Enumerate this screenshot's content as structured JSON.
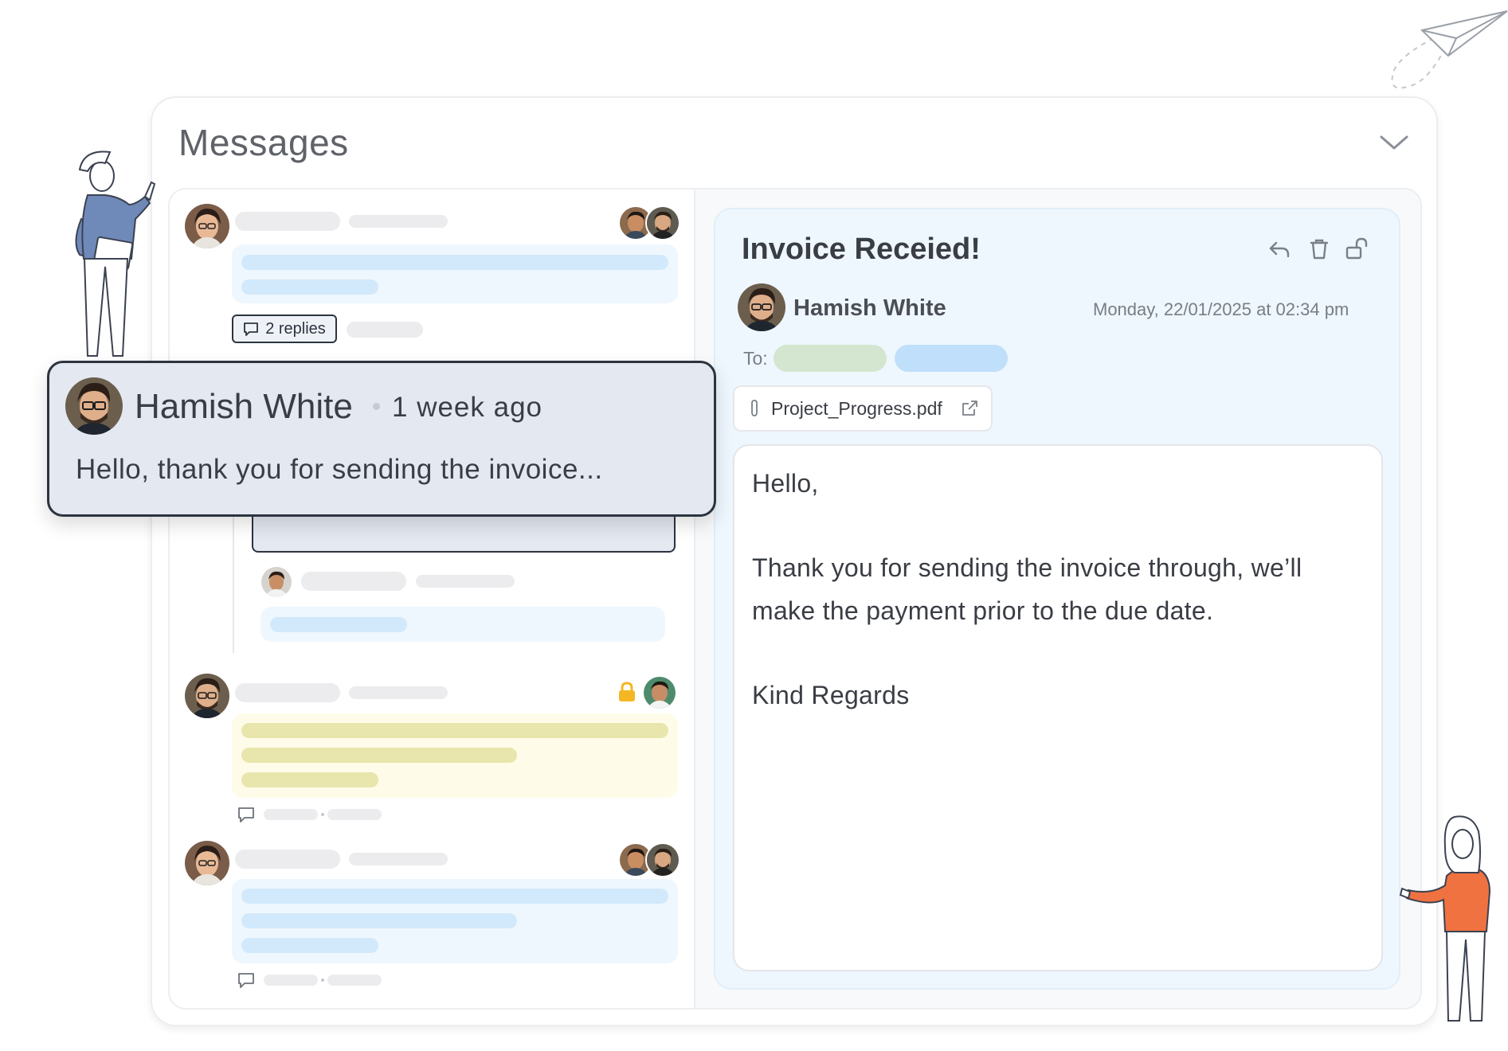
{
  "card": {
    "title": "Messages"
  },
  "thread": {
    "replies_label": "2 replies"
  },
  "popup": {
    "sender": "Hamish White",
    "time": "1 week ago",
    "preview": "Hello, thank you for sending the invoice..."
  },
  "detail": {
    "title": "Invoice Receied!",
    "sender": "Hamish White",
    "datetime": "Monday, 22/01/2025 at 02:34 pm",
    "to_label": "To:",
    "attachment": "Project_Progress.pdf",
    "body": {
      "greeting": "Hello,",
      "line1": "Thank you for sending the invoice through, we’ll",
      "line2": "make the payment prior to the due date.",
      "signoff": "Kind Regards"
    }
  },
  "colors": {
    "accent_blue": "#d2e9fb",
    "detail_bg": "#eef7fd",
    "popup_bg": "#e3e8f1",
    "popup_border": "#2c3440",
    "lock": "#f4b623",
    "woman_shirt": "#f07241",
    "man_shirt": "#6f89b8"
  },
  "icons": [
    "chevron-down-icon",
    "reply-icon",
    "trash-icon",
    "unlock-icon",
    "paperclip-icon",
    "external-link-icon",
    "comment-icon",
    "lock-icon",
    "paper-plane-icon"
  ]
}
